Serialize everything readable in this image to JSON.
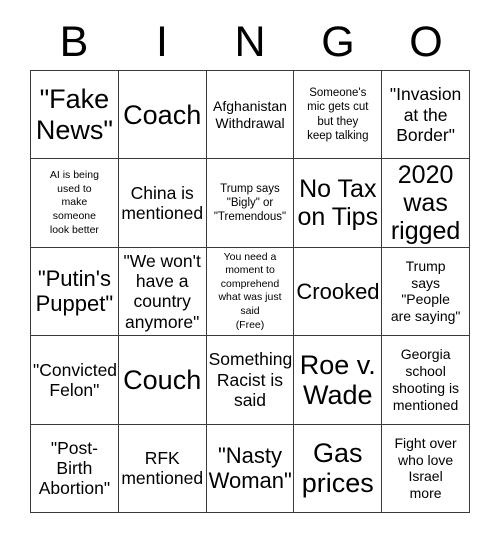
{
  "card": {
    "header_letters": [
      "B",
      "I",
      "N",
      "G",
      "O"
    ],
    "rows": [
      [
        {
          "text": "\"Fake\nNews\"",
          "size": "xxl"
        },
        {
          "text": "Coach",
          "size": "xxl"
        },
        {
          "text": "Afghanistan\nWithdrawal",
          "size": "sm"
        },
        {
          "text": "Someone's\nmic gets cut\nbut they\nkeep talking",
          "size": "xs"
        },
        {
          "text": "\"Invasion\nat the\nBorder\"",
          "size": "md"
        }
      ],
      [
        {
          "text": "AI is being\nused to\nmake\nsomeone\nlook better",
          "size": "xxs"
        },
        {
          "text": "China is\nmentioned",
          "size": "md"
        },
        {
          "text": "Trump says\n\"Bigly\" or\n\"Tremendous\"",
          "size": "xs"
        },
        {
          "text": "No Tax\non Tips",
          "size": "xl"
        },
        {
          "text": "2020\nwas\nrigged",
          "size": "xl"
        }
      ],
      [
        {
          "text": "\"Putin's\nPuppet\"",
          "size": "lg"
        },
        {
          "text": "\"We won't\nhave a\ncountry\nanymore\"",
          "size": "md"
        },
        {
          "text": "You need a\nmoment to\ncomprehend\nwhat was just\nsaid\n(Free)",
          "size": "xxs"
        },
        {
          "text": "Crooked",
          "size": "lg"
        },
        {
          "text": "Trump\nsays\n\"People\nare saying\"",
          "size": "sm"
        }
      ],
      [
        {
          "text": "\"Convicted\nFelon\"",
          "size": "md"
        },
        {
          "text": "Couch",
          "size": "xxl"
        },
        {
          "text": "Something\nRacist is\nsaid",
          "size": "md"
        },
        {
          "text": "Roe v.\nWade",
          "size": "xxl"
        },
        {
          "text": "Georgia\nschool\nshooting is\nmentioned",
          "size": "sm"
        }
      ],
      [
        {
          "text": "\"Post-\nBirth\nAbortion\"",
          "size": "md"
        },
        {
          "text": "RFK\nmentioned",
          "size": "md"
        },
        {
          "text": "\"Nasty\nWoman\"",
          "size": "lg"
        },
        {
          "text": "Gas\nprices",
          "size": "xxl"
        },
        {
          "text": "Fight over\nwho love\nIsrael\nmore",
          "size": "sm"
        }
      ]
    ]
  },
  "colors": {
    "background": "#ffffff",
    "text": "#000000",
    "grid_line": "#3a3a3a"
  }
}
